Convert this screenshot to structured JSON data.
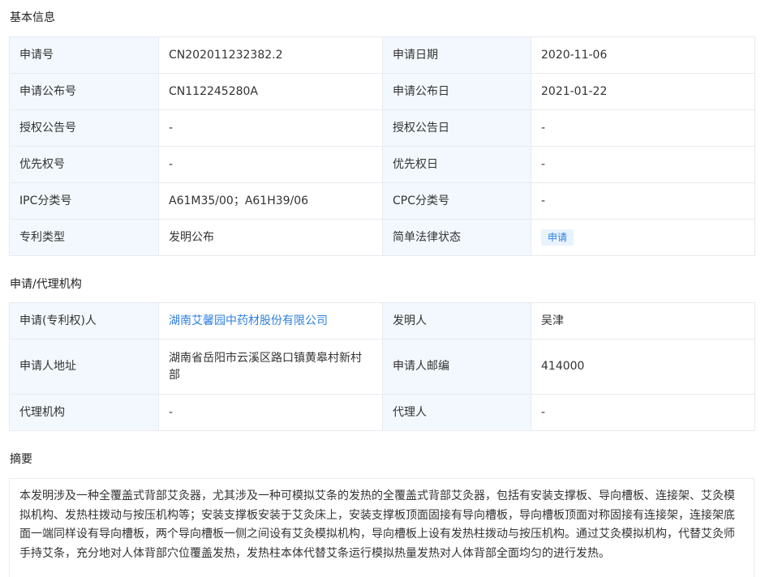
{
  "sections": {
    "basic": "基本信息",
    "agency": "申请/代理机构",
    "abstract": "摘要"
  },
  "basic": {
    "app_no_label": "申请号",
    "app_no": "CN202011232382.2",
    "app_date_label": "申请日期",
    "app_date": "2020-11-06",
    "pub_no_label": "申请公布号",
    "pub_no": "CN112245280A",
    "pub_date_label": "申请公布日",
    "pub_date": "2021-01-22",
    "grant_no_label": "授权公告号",
    "grant_no": "-",
    "grant_date_label": "授权公告日",
    "grant_date": "-",
    "priority_no_label": "优先权号",
    "priority_no": "-",
    "priority_date_label": "优先权日",
    "priority_date": "-",
    "ipc_label": "IPC分类号",
    "ipc": "A61M35/00；A61H39/06",
    "cpc_label": "CPC分类号",
    "cpc": "-",
    "type_label": "专利类型",
    "type": "发明公布",
    "status_label": "简单法律状态",
    "status": "申请"
  },
  "agency": {
    "applicant_label": "申请(专利权)人",
    "applicant": "湖南艾馨园中药材股份有限公司",
    "inventor_label": "发明人",
    "inventor": "吴津",
    "address_label": "申请人地址",
    "address": "湖南省岳阳市云溪区路口镇黄皋村新村部",
    "postcode_label": "申请人邮编",
    "postcode": "414000",
    "agency_label": "代理机构",
    "agency": "-",
    "agent_label": "代理人",
    "agent": "-"
  },
  "abstract": {
    "text": "本发明涉及一种全覆盖式背部艾灸器，尤其涉及一种可模拟艾条的发热的全覆盖式背部艾灸器，包括有安装支撑板、导向槽板、连接架、艾灸模拟机构、发热柱拨动与按压机构等；安装支撑板安装于艾灸床上，安装支撑板顶面固接有导向槽板，导向槽板顶面对称固接有连接架，连接架底面一端同样设有导向槽板，两个导向槽板一侧之间设有艾灸模拟机构，导向槽板上设有发热柱拨动与按压机构。通过艾灸模拟机构，代替艾灸师手持艾条，充分地对人体背部穴位覆盖发热，发热柱本体代替艾条运行模拟热量发热对人体背部全面均匀的进行发热。"
  },
  "colors": {
    "label_bg": "#f2f8fe",
    "border": "#e8eaef",
    "link": "#2f7fdd",
    "badge_bg": "#e8f3fe"
  }
}
